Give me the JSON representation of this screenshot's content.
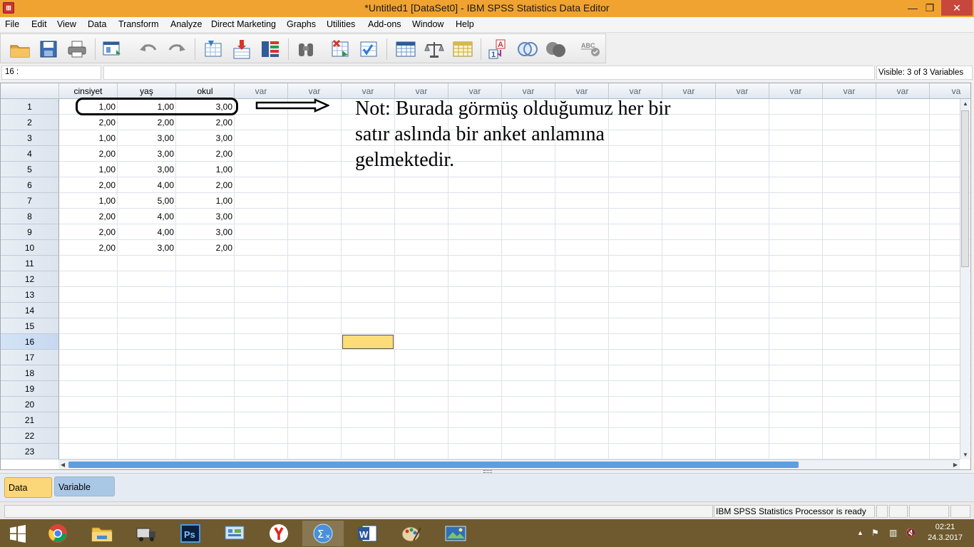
{
  "window": {
    "title": "*Untitled1 [DataSet0] - IBM SPSS Statistics Data Editor",
    "minimize": "—",
    "maximize": "❐",
    "close": "✕"
  },
  "menu": [
    "File",
    "Edit",
    "View",
    "Data",
    "Transform",
    "Analyze",
    "Direct Marketing",
    "Graphs",
    "Utilities",
    "Add-ons",
    "Window",
    "Help"
  ],
  "toolbar": {
    "icons": [
      "open-folder-icon",
      "save-icon",
      "print-icon",
      "dialog-recall-icon",
      "undo-icon",
      "redo-icon",
      "goto-case-icon",
      "goto-variable-icon",
      "variables-icon",
      "find-icon",
      "insert-cases-icon",
      "insert-variable-icon",
      "split-file-icon",
      "weight-cases-icon",
      "select-cases-icon",
      "value-labels-icon",
      "use-variable-sets-icon",
      "show-all-variables-icon",
      "spell-check-icon"
    ],
    "abc_label": "ABC"
  },
  "cell_editor": {
    "reference": "16 :",
    "value": "",
    "visible_vars": "Visible: 3 of 3 Variables"
  },
  "grid": {
    "columns": [
      "cinsiyet",
      "yaş",
      "okul",
      "var",
      "var",
      "var",
      "var",
      "var",
      "var",
      "var",
      "var",
      "var",
      "var",
      "var",
      "var",
      "var",
      "va"
    ],
    "row_numbers": [
      "1",
      "2",
      "3",
      "4",
      "5",
      "6",
      "7",
      "8",
      "9",
      "10",
      "11",
      "12",
      "13",
      "14",
      "15",
      "16",
      "17",
      "18",
      "19",
      "20",
      "21",
      "22",
      "23"
    ],
    "rows": [
      [
        "1,00",
        "1,00",
        "3,00"
      ],
      [
        "2,00",
        "2,00",
        "2,00"
      ],
      [
        "1,00",
        "3,00",
        "3,00"
      ],
      [
        "2,00",
        "3,00",
        "2,00"
      ],
      [
        "1,00",
        "3,00",
        "1,00"
      ],
      [
        "2,00",
        "4,00",
        "2,00"
      ],
      [
        "1,00",
        "5,00",
        "1,00"
      ],
      [
        "2,00",
        "4,00",
        "3,00"
      ],
      [
        "2,00",
        "4,00",
        "3,00"
      ],
      [
        "2,00",
        "3,00",
        "2,00"
      ]
    ],
    "active_row": "16"
  },
  "annotation": {
    "lines": [
      "Not: Burada görmüş olduğumuz her bir",
      "satır aslında bir anket anlamına",
      "gelmektedir."
    ]
  },
  "tabs": {
    "data_view": "Data View",
    "variable_view": "Variable View"
  },
  "status": {
    "processor": "IBM SPSS Statistics Processor is ready"
  },
  "taskbar": {
    "apps": [
      "start-icon",
      "chrome-icon",
      "file-explorer-icon",
      "truck-game-icon",
      "photoshop-icon",
      "control-panel-icon",
      "yandex-icon",
      "spss-icon",
      "word-icon",
      "paint-icon",
      "photos-icon"
    ],
    "active_app": "spss-icon",
    "time": "02:21",
    "date": "24.3.2017"
  },
  "colors": {
    "titlebar": "#f0a330",
    "active_cell": "#ffdc7a",
    "taskbar": "#6e5a2e",
    "data_view_tab": "#fcd77a",
    "variable_view_tab": "#a9c8e6"
  }
}
